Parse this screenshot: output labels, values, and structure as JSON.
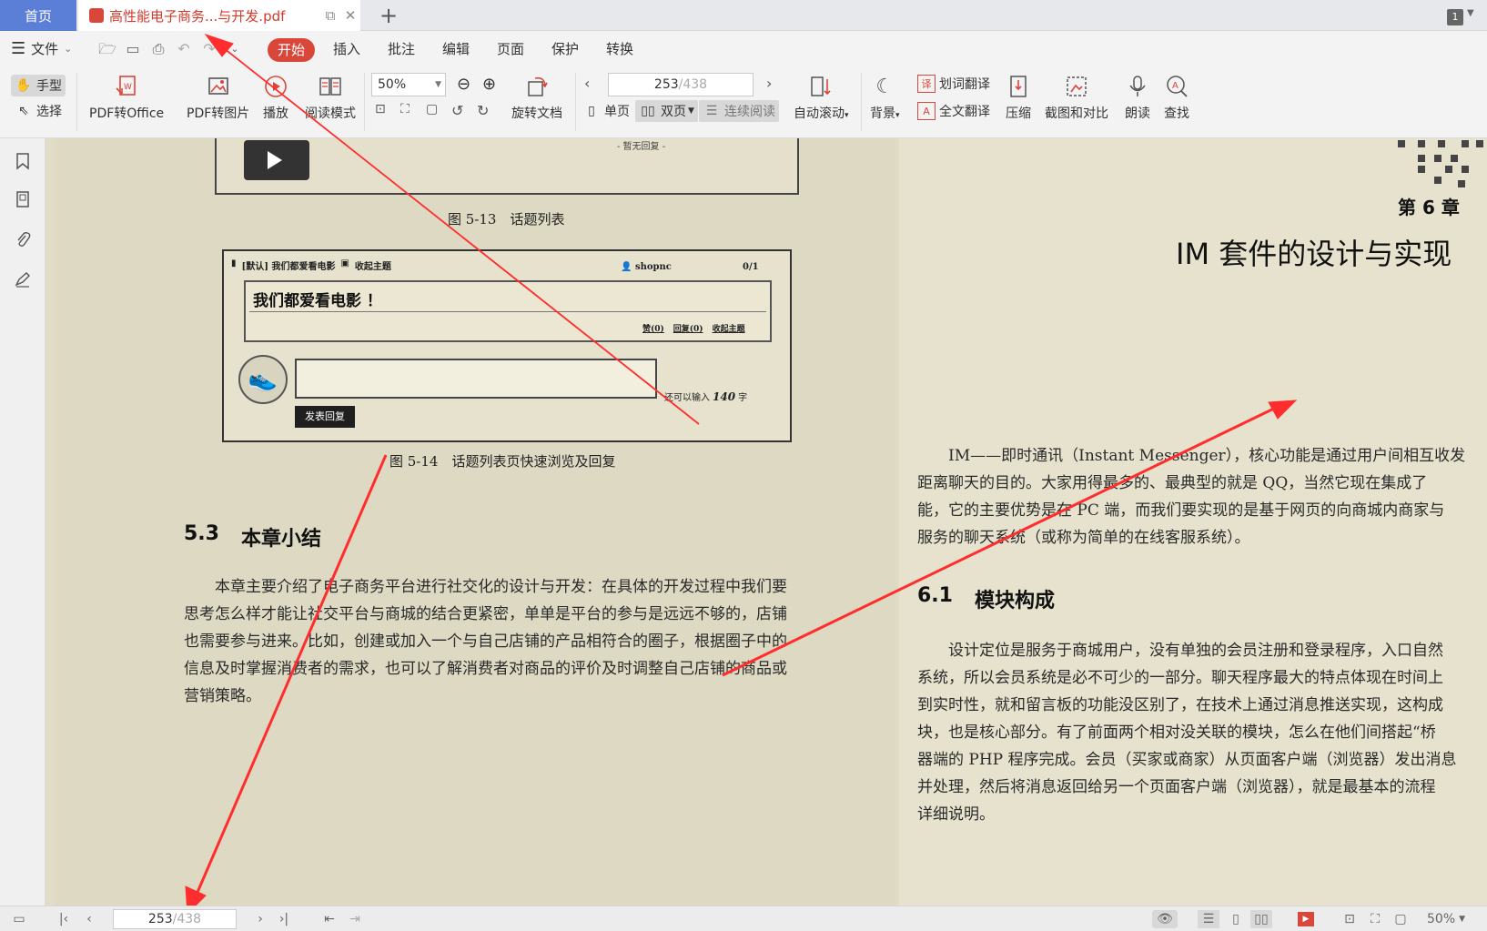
{
  "tabs": {
    "home": "首页",
    "document": "高性能电子商务...与开发.pdf",
    "window_count": "1"
  },
  "menu": {
    "file": "文件",
    "items": [
      "开始",
      "插入",
      "批注",
      "编辑",
      "页面",
      "保护",
      "转换"
    ]
  },
  "ribbon": {
    "hand": "手型",
    "select": "选择",
    "pdf_to_office": "PDF转Office",
    "pdf_to_image": "PDF转图片",
    "play": "播放",
    "read_mode": "阅读模式",
    "zoom": "50%",
    "rotate_doc": "旋转文档",
    "page_current": "253",
    "page_total": "/438",
    "single_page": "单页",
    "double_page": "双页",
    "continuous": "连续阅读",
    "auto_scroll": "自动滚动",
    "background": "背景",
    "word_translate": "划词翻译",
    "full_translate": "全文翻译",
    "compress": "压缩",
    "screenshot_compare": "截图和对比",
    "read_aloud": "朗读",
    "find": "查找"
  },
  "left_page": {
    "fig_top_caption": "图 5-13　话题列表",
    "no_reply": "- 暂无回复 -",
    "ui_mock": {
      "header": "[默认]  我们都爱看电影",
      "collect": "收起主题",
      "user": "shopnc",
      "count": "0/1",
      "title": "我们都爱看电影 ！",
      "links": [
        "赞(0)",
        "回复(0)",
        "收起主题"
      ],
      "char_left": "还可以输入",
      "char_num": "140",
      "char_unit": "字",
      "submit": "发表回复"
    },
    "fig_caption": "图 5-14　话题列表页快速浏览及回复",
    "section_num": "5.3",
    "section_title": "本章小结",
    "paragraph": [
      "本章主要介绍了电子商务平台进行社交化的设计与开发：在具体的开发过程中我们要",
      "思考怎么样才能让社交平台与商城的结合更紧密，单单是平台的参与是远远不够的，店铺",
      "也需要参与进来。比如，创建或加入一个与自己店铺的产品相符合的圈子，根据圈子中的",
      "信息及时掌握消费者的需求，也可以了解消费者对商品的评价及时调整自己店铺的商品或",
      "营销策略。"
    ]
  },
  "right_page": {
    "chapter": "第 6 章",
    "title": "IM 套件的设计与实现",
    "intro": [
      "IM——即时通讯（Instant Messenger），核心功能是通过用户间相互收发",
      "距离聊天的目的。大家用得最多的、最典型的就是 QQ，当然它现在集成了",
      "能，它的主要优势是在 PC 端，而我们要实现的是基于网页的向商城内商家与",
      "服务的聊天系统（或称为简单的在线客服系统）。"
    ],
    "section_num": "6.1",
    "section_title": "模块构成",
    "body": [
      "设计定位是服务于商城用户，没有单独的会员注册和登录程序，入口自然",
      "系统，所以会员系统是必不可少的一部分。聊天程序最大的特点体现在时间上",
      "到实时性，就和留言板的功能没区别了，在技术上通过消息推送实现，这构成",
      "块，也是核心部分。有了前面两个相对没关联的模块，怎么在他们间搭起“桥",
      "器端的 PHP 程序完成。会员（买家或商家）从页面客户端（浏览器）发出消息",
      "并处理，然后将消息返回给另一个页面客户端（浏览器），就是最基本的流程",
      "详细说明。"
    ]
  },
  "statusbar": {
    "page_current": "253",
    "page_total": "/438",
    "zoom": "50%"
  },
  "colors": {
    "accent_red": "#d9473b",
    "home_tab_blue": "#5b7fd6",
    "annotation_arrow": "#ff2d2d"
  }
}
